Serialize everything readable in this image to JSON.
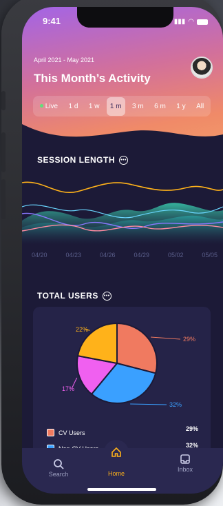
{
  "status": {
    "time": "9:41"
  },
  "header": {
    "date_range": "April 2021 - May 2021",
    "title": "This Month’s Activity",
    "avatar_icon": "user-avatar"
  },
  "tabs": [
    {
      "label": "Live",
      "live": true
    },
    {
      "label": "1 d"
    },
    {
      "label": "1 w"
    },
    {
      "label": "1 m",
      "active": true
    },
    {
      "label": "3 m"
    },
    {
      "label": "6 m"
    },
    {
      "label": "1 y"
    },
    {
      "label": "All"
    }
  ],
  "session": {
    "title": "SESSION LENGTH",
    "ticks": [
      "04/20",
      "04/23",
      "04/26",
      "04/29",
      "05/02",
      "05/05"
    ]
  },
  "users": {
    "title": "TOTAL USERS",
    "legend": [
      {
        "label": "CV Users",
        "value": "29%",
        "color": "#f07a60"
      },
      {
        "label": "Non-CV Users",
        "value": "32%",
        "color": "#3aa0ff"
      }
    ]
  },
  "chart_data": {
    "type": "pie",
    "slices": [
      {
        "value": 29,
        "label": "29%",
        "color": "#f07a60"
      },
      {
        "value": 32,
        "label": "32%",
        "color": "#3aa0ff"
      },
      {
        "value": 17,
        "label": "17%",
        "color": "#f060f0"
      },
      {
        "value": 22,
        "label": "22%",
        "color": "#ffb21a"
      }
    ]
  },
  "nav": {
    "search": "Search",
    "home": "Home",
    "inbox": "Inbox"
  },
  "colors": {
    "accent": "#ffb21a",
    "background": "#1c1a37"
  }
}
